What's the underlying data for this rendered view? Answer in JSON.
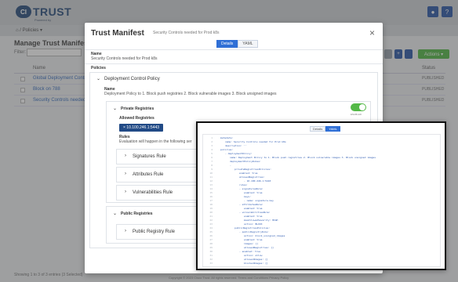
{
  "app": {
    "logo_badge": "CI",
    "logo_text": "TRUST",
    "logo_sub": "Powered by",
    "crumb": "⌂ / Policies ▾",
    "page_title": "Manage Trust Manifests",
    "filter_label": "Filter:",
    "actions_label": "Actions ▾",
    "table_head": {
      "name": "Name",
      "status": "Status"
    },
    "rows": [
      {
        "name": "Global Deployment Control Po",
        "status": "PUBLISHED"
      },
      {
        "name": "Block on 788",
        "status": "PUBLISHED"
      },
      {
        "name": "Security Controls needed for Pr",
        "status": "PUBLISHED"
      }
    ],
    "footer": "Showing 1 to 3 of 3 entries (3 Selected)",
    "copyright": "Copyright © 2023 Cisco Trust. All rights reserved. Terms and Conditions   Privacy Policy"
  },
  "modal": {
    "title": "Trust Manifest",
    "description": "Security Controls needed for Prod k8s",
    "tabs": [
      {
        "label": "Details",
        "active": true
      },
      {
        "label": "YAML",
        "active": false
      }
    ],
    "name_label": "Name",
    "name_value": "Security Controls needed for Prod k8s",
    "policies_label": "Policies",
    "deployment_policy": "Deployment Control Policy",
    "policy_name_label": "Name",
    "policy_name_value": "Deployment Policy to 1. Block push registries 2. Block vulnerable images 3. Block unsigned images",
    "private_registries": "Private Registries",
    "enabled_label": "ENABLED",
    "allowed_registries": "Allowed Registries",
    "registry_chip": "× 10.100.246.1:5443",
    "rules_label": "Rules",
    "rules_text": "Evaluation will happen in the following ser",
    "rules": [
      "Signatures Rule",
      "Attributes Rule",
      "Vulnerabilities Rule"
    ],
    "public_registries": "Public Registries",
    "public_rule": "Public Registry Rule"
  },
  "yaml_view": {
    "tabs": [
      {
        "label": "Details",
        "active": false
      },
      {
        "label": "YAML",
        "active": true
      }
    ],
    "lines": [
      {
        "n": "1",
        "t": "metadata:",
        "i": 0
      },
      {
        "n": "2",
        "t": "name: Security Controls needed for Prod k8s",
        "i": 1
      },
      {
        "n": "3",
        "t": "description: ''",
        "i": 1
      },
      {
        "n": "4",
        "t": "policies:",
        "i": 0
      },
      {
        "n": "5",
        "t": "- deploymentPolicy:",
        "i": 1
      },
      {
        "n": "6",
        "t": "name: Deployment Policy to 1. Block push registries 2. Block vulnerable images 3. Block unsigned images",
        "i": 2
      },
      {
        "n": "7",
        "t": "deploymentPolicyRules:",
        "i": 2
      },
      {
        "n": "8",
        "t": "- ",
        "i": 2
      },
      {
        "n": "9",
        "t": "privateRegistriesPolicies:",
        "i": 3
      },
      {
        "n": "10",
        "t": "enabled: true",
        "i": 4
      },
      {
        "n": "11",
        "t": "allowedRegistries:",
        "i": 4
      },
      {
        "n": "12",
        "t": "- 10.100.246.1:5443",
        "i": 5
      },
      {
        "n": "13",
        "t": "rules:",
        "i": 4
      },
      {
        "n": "14",
        "t": "- signaturesRule:",
        "i": 4
      },
      {
        "n": "15",
        "t": "enabled: true",
        "i": 5
      },
      {
        "n": "16",
        "t": "keys:",
        "i": 5
      },
      {
        "n": "17",
        "t": "- name: signature-key",
        "i": 5
      },
      {
        "n": "18",
        "t": "- attributesRule:",
        "i": 4
      },
      {
        "n": "19",
        "t": "enabled: true",
        "i": 5
      },
      {
        "n": "20",
        "t": "- vulnerabilitiesRule:",
        "i": 4
      },
      {
        "n": "21",
        "t": "enabled: true",
        "i": 5
      },
      {
        "n": "22",
        "t": "maxAllowedSeverity: HIGH",
        "i": 5
      },
      {
        "n": "23",
        "t": "action: BLOCK",
        "i": 5
      },
      {
        "n": "24",
        "t": "publicRegistriesPolicies:",
        "i": 3
      },
      {
        "n": "25",
        "t": "- publicRegistryRule:",
        "i": 4
      },
      {
        "n": "26",
        "t": "action: block_unsigned_images",
        "i": 5
      },
      {
        "n": "27",
        "t": "enabled: true",
        "i": 5
      },
      {
        "n": "28",
        "t": "images: []",
        "i": 5
      },
      {
        "n": "29",
        "t": "allowedRegistries: []",
        "i": 5
      },
      {
        "n": "30",
        "t": "- enabled: true",
        "i": 4
      },
      {
        "n": "31",
        "t": "action: allow",
        "i": 5
      },
      {
        "n": "32",
        "t": "allowedImages: []",
        "i": 5
      },
      {
        "n": "33",
        "t": "blockedImages: []",
        "i": 5
      }
    ]
  },
  "colors": {
    "accent": "#2f6fd6",
    "brand": "#2b4f7e",
    "enabled": "#54b947",
    "chip": "#214a86"
  },
  "icons": {
    "close": "close-icon",
    "chevron": "chevron-icon",
    "checkbox": "checkbox-icon"
  }
}
